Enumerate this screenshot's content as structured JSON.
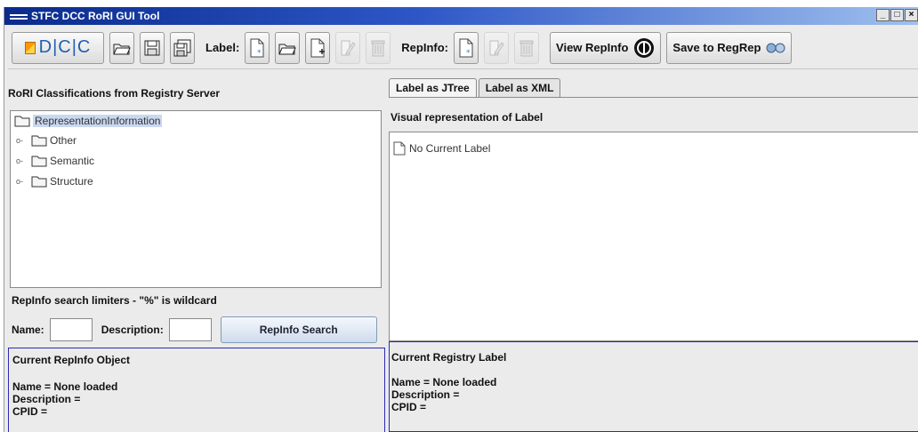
{
  "window": {
    "title": "STFC DCC RoRI GUI Tool",
    "buttons": [
      "_",
      "□",
      "×"
    ]
  },
  "toolbar": {
    "logo_text": "D|C|C",
    "label_label": "Label:",
    "repinfo_label": "RepInfo:",
    "view_repinfo": "View RepInfo",
    "save_to_regrep": "Save to RegRep"
  },
  "left": {
    "title": "RoRI Classifications from Registry Server",
    "tree": {
      "root": "RepresentationInformation",
      "children": [
        "Other",
        "Semantic",
        "Structure"
      ]
    },
    "search": {
      "title": "RepInfo search limiters - \"%\" is wildcard",
      "name_label": "Name:",
      "name_value": "",
      "description_label": "Description:",
      "description_value": "",
      "button": "RepInfo Search"
    },
    "current": {
      "title": "Current RepInfo Object",
      "name": "Name = None loaded",
      "description": "Description =",
      "cpid": "CPID ="
    }
  },
  "right": {
    "tabs": [
      "Label as JTree",
      "Label as XML"
    ],
    "active_tab": "Label as JTree",
    "visual_title": "Visual representation of Label",
    "empty_label": "No Current Label",
    "current": {
      "title": "Current Registry Label",
      "name": "Name = None loaded",
      "description": "Description =",
      "cpid": "CPID ="
    }
  }
}
